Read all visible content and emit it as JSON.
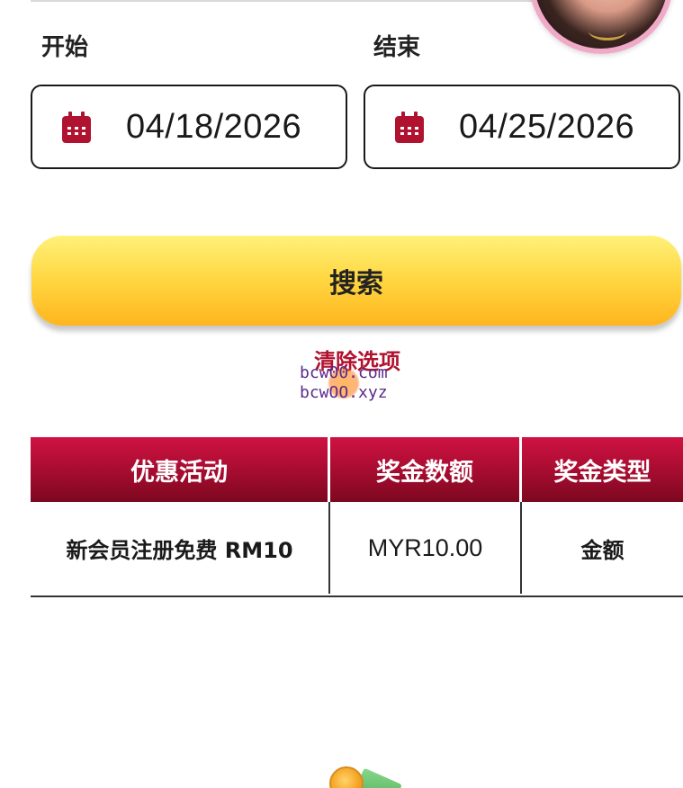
{
  "filters": {
    "start_label": "开始",
    "end_label": "结束",
    "start_date": "04/18/2026",
    "end_date": "04/25/2026"
  },
  "actions": {
    "search_label": "搜索",
    "clear_label": "清除选项"
  },
  "watermark": {
    "line1": "bcw00.com",
    "line2": "bcwOO.xyz"
  },
  "table": {
    "headers": [
      "优惠活动",
      "奖金数额",
      "奖金类型"
    ],
    "rows": [
      {
        "promotion": "新会员注册免费 RM10",
        "amount": "MYR10.00",
        "type": "金额"
      }
    ]
  },
  "colors": {
    "accent": "#b0122f",
    "button_gold": "#ffd640",
    "header_red": "#a50c2f"
  }
}
